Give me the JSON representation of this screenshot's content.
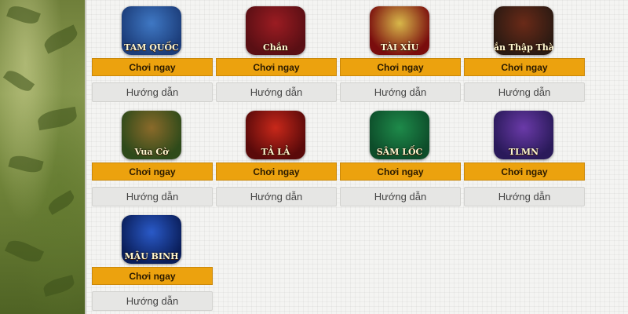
{
  "games": [
    {
      "title": "TAM QUỐC",
      "play_label": "Chơi ngay",
      "guide_label": "Hướng dẫn",
      "icon": "tam-quoc-icon",
      "colors": [
        "#1c3d7a",
        "#3f78c4"
      ]
    },
    {
      "title": "Chắn",
      "play_label": "Chơi ngay",
      "guide_label": "Hướng dẫn",
      "icon": "chan-icon",
      "colors": [
        "#5a0f14",
        "#9b1c22"
      ]
    },
    {
      "title": "TÀI XỈU",
      "play_label": "Chơi ngay",
      "guide_label": "Hướng dẫn",
      "icon": "tai-xiu-icon",
      "colors": [
        "#7a0d0d",
        "#d8b84a"
      ]
    },
    {
      "title": "Chắn Thập Thành",
      "play_label": "Chơi ngay",
      "guide_label": "Hướng dẫn",
      "icon": "chan-thap-thanh-icon",
      "colors": [
        "#2b1a12",
        "#6a2a18"
      ]
    },
    {
      "title": "Vua Cờ",
      "play_label": "Chơi ngay",
      "guide_label": "Hướng dẫn",
      "icon": "vua-co-icon",
      "colors": [
        "#2e4a1a",
        "#8a6a2a"
      ]
    },
    {
      "title": "TẢ LẢ",
      "play_label": "Chơi ngay",
      "guide_label": "Hướng dẫn",
      "icon": "ta-la-icon",
      "colors": [
        "#5a0a0a",
        "#c8281a"
      ]
    },
    {
      "title": "SÂM LỐC",
      "play_label": "Chơi ngay",
      "guide_label": "Hướng dẫn",
      "icon": "sam-loc-icon",
      "colors": [
        "#0d4d2a",
        "#1e8a4a"
      ]
    },
    {
      "title": "TLMN",
      "play_label": "Chơi ngay",
      "guide_label": "Hướng dẫn",
      "icon": "tlmn-icon",
      "colors": [
        "#2a1a5a",
        "#6a3aa8"
      ]
    },
    {
      "title": "MẬU BINH",
      "play_label": "Chơi ngay",
      "guide_label": "Hướng dẫn",
      "icon": "mau-binh-icon",
      "colors": [
        "#0a1e5a",
        "#2a5ac8"
      ]
    }
  ]
}
